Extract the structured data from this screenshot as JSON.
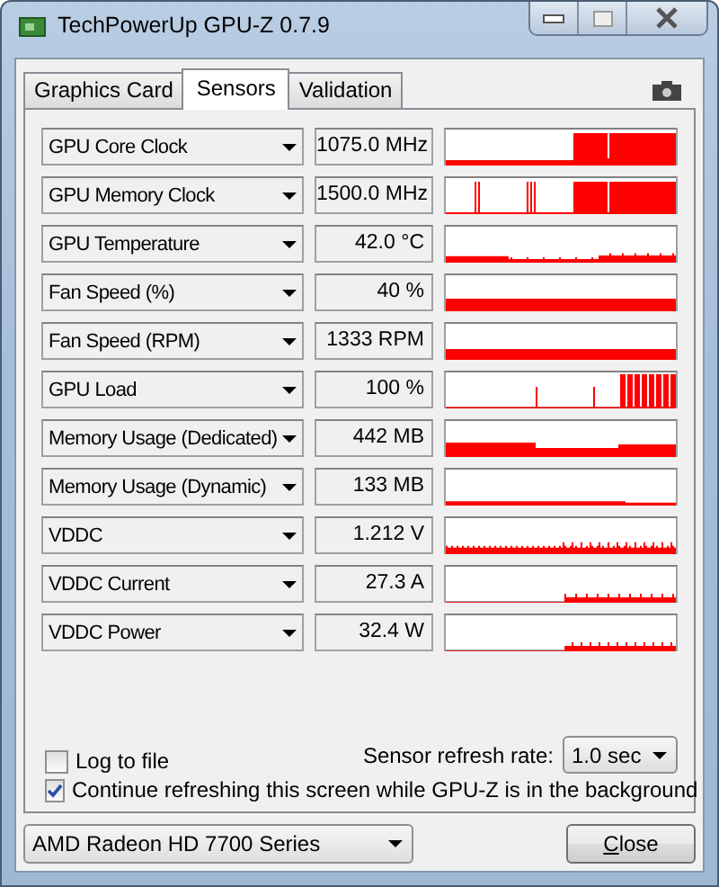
{
  "window": {
    "title": "TechPowerUp GPU-Z 0.7.9"
  },
  "tabs": [
    {
      "label": "Graphics Card",
      "selected": false
    },
    {
      "label": "Sensors",
      "selected": true
    },
    {
      "label": "Validation",
      "selected": false
    }
  ],
  "sensors": [
    {
      "name": "GPU Core Clock",
      "reading": "1075.0 MHz"
    },
    {
      "name": "GPU Memory Clock",
      "reading": "1500.0 MHz"
    },
    {
      "name": "GPU Temperature",
      "reading": "42.0 °C"
    },
    {
      "name": "Fan Speed (%)",
      "reading": "40 %"
    },
    {
      "name": "Fan Speed (RPM)",
      "reading": "1333 RPM"
    },
    {
      "name": "GPU Load",
      "reading": "100 %"
    },
    {
      "name": "Memory Usage (Dedicated)",
      "reading": "442 MB"
    },
    {
      "name": "Memory Usage (Dynamic)",
      "reading": "133 MB"
    },
    {
      "name": "VDDC",
      "reading": "1.212 V"
    },
    {
      "name": "VDDC Current",
      "reading": "27.3 A"
    },
    {
      "name": "VDDC Power",
      "reading": "32.4 W"
    }
  ],
  "log_to_file": {
    "label": "Log to file",
    "checked": false
  },
  "refresh_rate": {
    "label": "Sensor refresh rate:",
    "value": "1.0 sec"
  },
  "continue_refreshing": {
    "label": "Continue refreshing this screen while GPU-Z is in the background",
    "checked": true
  },
  "gpu_select": {
    "value": "AMD Radeon HD 7700 Series"
  },
  "close_button": {
    "label": "Close"
  }
}
